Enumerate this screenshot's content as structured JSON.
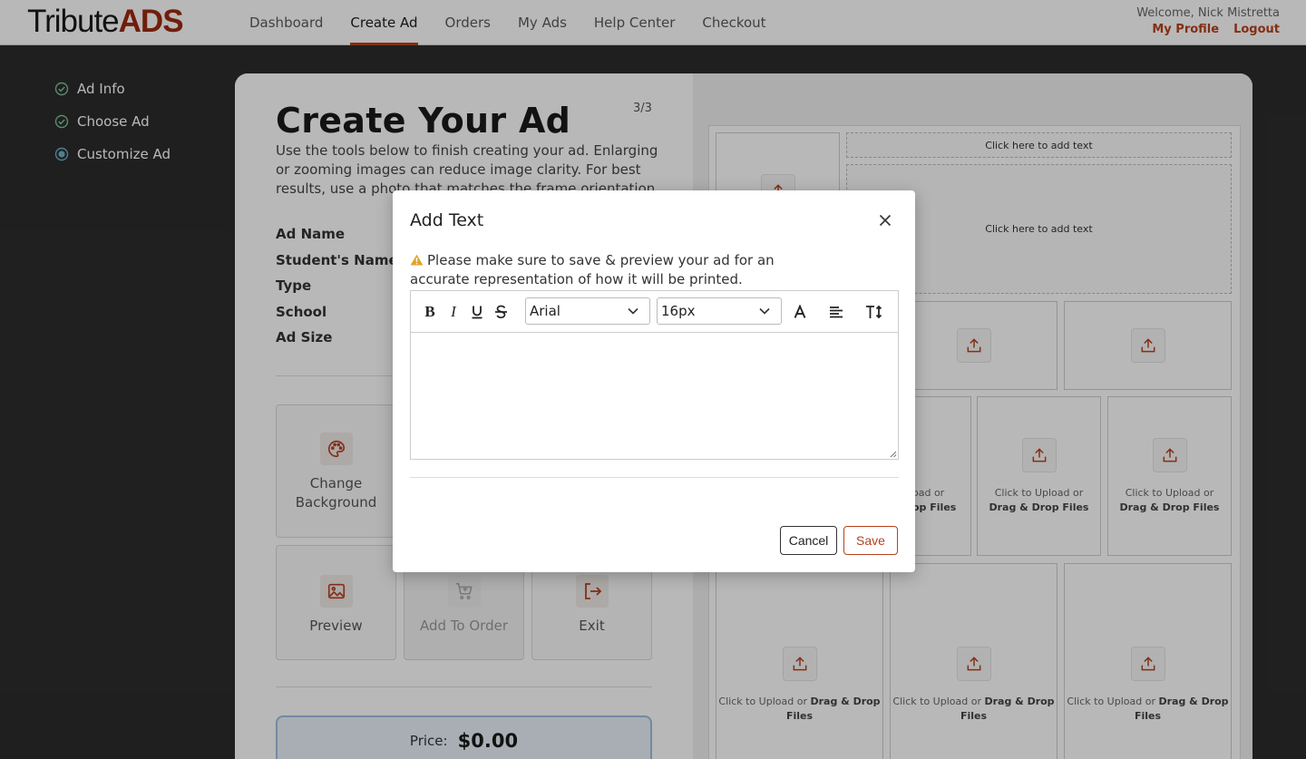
{
  "brand": {
    "logo_part1": "Tribute",
    "logo_part2": "ADS",
    "accent_color": "#b8401e"
  },
  "nav": {
    "items": [
      {
        "label": "Dashboard"
      },
      {
        "label": "Create Ad",
        "active": true
      },
      {
        "label": "Orders"
      },
      {
        "label": "My Ads"
      },
      {
        "label": "Help Center"
      },
      {
        "label": "Checkout"
      }
    ]
  },
  "user": {
    "welcome": "Welcome, Nick Mistretta",
    "profile_link": "My Profile",
    "logout_link": "Logout"
  },
  "sidebar": {
    "steps": [
      {
        "label": "Ad Info",
        "status": "complete"
      },
      {
        "label": "Choose Ad",
        "status": "complete"
      },
      {
        "label": "Customize Ad",
        "status": "current"
      }
    ]
  },
  "main": {
    "title": "Create Your Ad",
    "step_count": "3/3",
    "description": "Use the tools below to finish creating your ad. Enlarging or zooming images can reduce image clarity. For best results, use a photo that matches the frame orientation.",
    "info_labels": [
      "Ad Name",
      "Student's Name",
      "Type",
      "School",
      "Ad Size"
    ],
    "actions": {
      "change_background": "Change Background",
      "preview": "Preview",
      "add_to_order": "Add To Order",
      "exit": "Exit"
    },
    "price_label": "Price:",
    "price_value": "$0.00"
  },
  "canvas": {
    "text_placeholder": "Click here to add text",
    "upload_prefix": "Click to Upload or ",
    "upload_bold": "Drag & Drop Files",
    "partial_text1": "oad or",
    "partial_text2": "op Files"
  },
  "modal": {
    "title": "Add Text",
    "warning": "Please make sure to save & preview your ad for an accurate representation of how it will be printed.",
    "font_family": "Arial",
    "font_size": "16px",
    "toolbar_icons": [
      "bold-icon",
      "italic-icon",
      "underline-icon",
      "strikethrough-icon",
      "text-color-icon",
      "align-left-icon",
      "line-height-icon"
    ],
    "text_value": "",
    "cancel_label": "Cancel",
    "save_label": "Save"
  }
}
